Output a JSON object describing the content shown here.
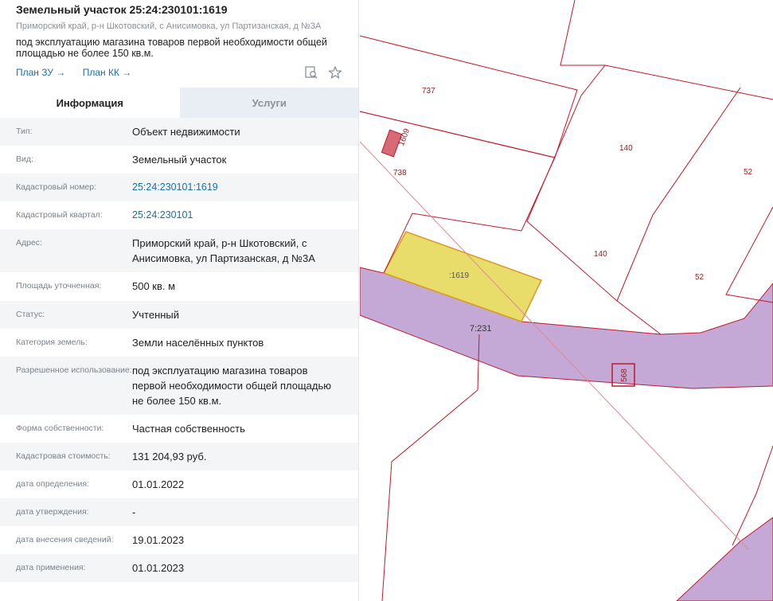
{
  "header": {
    "title": "Земельный участок 25:24:230101:1619",
    "address": "Приморский край, р-н Шкотовский, с Анисимовка, ул Партизанская, д №3А",
    "purpose": "под эксплуатацию магазина товаров первой необходимости общей площадью не более 150 кв.м.",
    "plan_zu": "План ЗУ →",
    "plan_kk": "План КК →",
    "icons": [
      "search-document-icon",
      "star-icon"
    ]
  },
  "tabs": [
    {
      "label": "Информация",
      "active": true
    },
    {
      "label": "Услуги",
      "active": false
    }
  ],
  "rows": [
    {
      "label": "Тип:",
      "value": "Объект недвижимости"
    },
    {
      "label": "Вид:",
      "value": "Земельный участок"
    },
    {
      "label": "Кадастровый номер:",
      "value": "25:24:230101:1619",
      "link": true
    },
    {
      "label": "Кадастровый квартал:",
      "value": "25:24:230101",
      "link": true
    },
    {
      "label": "Адрес:",
      "value": "Приморский край, р-н Шкотовский, с Анисимовка, ул Партизанская, д №3А"
    },
    {
      "label": "Площадь уточненная:",
      "value": "500 кв. м"
    },
    {
      "label": "Статус:",
      "value": "Учтенный"
    },
    {
      "label": "Категория земель:",
      "value": "Земли населённых пунктов"
    },
    {
      "label": "Разрешенное использование:",
      "value": "под эксплуатацию магазина товаров первой необходимости общей площадью не более 150 кв.м."
    },
    {
      "label": "Форма собственности:",
      "value": "Частная собственность"
    },
    {
      "label": "Кадастровая стоимость:",
      "value": "131 204,93 руб."
    },
    {
      "label": "дата определения:",
      "value": "01.01.2022"
    },
    {
      "label": "дата утверждения:",
      "value": "-"
    },
    {
      "label": "дата внесения сведений:",
      "value": "19.01.2023"
    },
    {
      "label": "дата применения:",
      "value": "01.01.2023"
    }
  ],
  "map": {
    "labels": [
      "737",
      "1609",
      "738",
      "140",
      "52",
      "140",
      "52",
      ":1619",
      "7:231",
      "568"
    ],
    "colors": {
      "border": "#c0182b",
      "road": "#c4a9d6",
      "selected": "#e8dd6a",
      "selected_border": "#d99a1c"
    }
  }
}
